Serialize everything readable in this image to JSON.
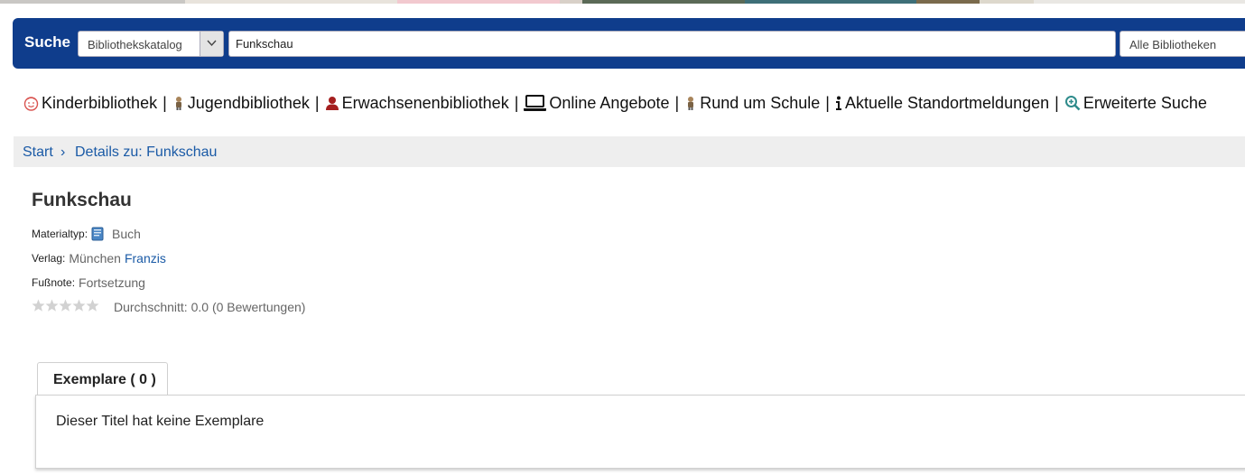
{
  "search": {
    "label": "Suche",
    "catalog_value": "Bibliothekskatalog",
    "query_value": "Funkschau",
    "library_value": "Alle Bibliotheken"
  },
  "nav": {
    "items": [
      {
        "label": "Kinderbibliothek",
        "icon": "child-face-icon"
      },
      {
        "label": "Jugendbibliothek",
        "icon": "teen-figure-icon"
      },
      {
        "label": "Erwachsenenbibliothek",
        "icon": "adult-user-icon"
      },
      {
        "label": "Online Angebote",
        "icon": "laptop-icon"
      },
      {
        "label": "Rund um Schule",
        "icon": "student-figure-icon"
      },
      {
        "label": "Aktuelle Standortmeldungen",
        "icon": "info-icon"
      },
      {
        "label": "Erweiterte Suche",
        "icon": "magnifier-plus-icon"
      }
    ],
    "separator": "|"
  },
  "breadcrumb": {
    "start": "Start",
    "separator": "›",
    "current": "Details zu: Funkschau"
  },
  "record": {
    "title": "Funkschau",
    "material_label": "Materialtyp:",
    "material_value": "Buch",
    "publisher_label": "Verlag:",
    "publisher_place": "München",
    "publisher_name": "Franzis",
    "footnote_label": "Fußnote:",
    "footnote_value": "Fortsetzung",
    "rating_stars": 0,
    "rating_max": 5,
    "rating_text": "Durchschnitt: 0.0 (0 Bewertungen)"
  },
  "tabs": {
    "active_label": "Exemplare ( 0 )",
    "panel_text": "Dieser Titel hat keine Exemplare"
  },
  "colors": {
    "search_bg": "#0f3d8c",
    "link": "#1a5aa6",
    "breadcrumb_bg": "#eeeeee"
  }
}
